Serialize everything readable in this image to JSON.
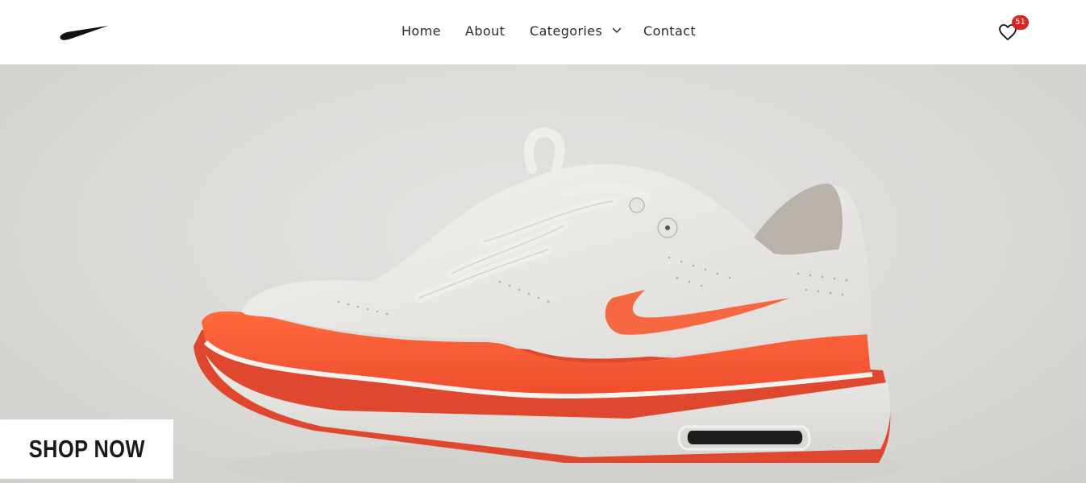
{
  "header": {
    "logo_icon": "nike-swoosh-icon",
    "nav": {
      "home": "Home",
      "about": "About",
      "categories": "Categories",
      "contact": "Contact"
    },
    "categories_icon": "chevron-down-icon",
    "wishlist_icon": "heart-icon",
    "wishlist_count": "51"
  },
  "hero": {
    "image": "orange-white-sneaker-photo",
    "cta_label": "SHOP NOW"
  },
  "colors": {
    "badge": "#d92424",
    "text": "#2b2b2b",
    "hero_background": "#dcdbd8",
    "shoe_accent": "#f25a3c"
  }
}
